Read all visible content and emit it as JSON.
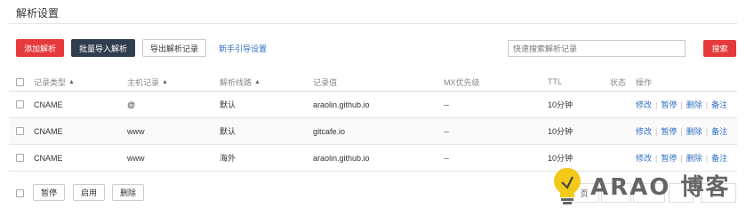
{
  "page": {
    "title": "解析设置"
  },
  "toolbar": {
    "add_label": "添加解析",
    "batch_import_label": "批量导入解析",
    "export_label": "导出解析记录",
    "guide_label": "新手引导设置"
  },
  "search": {
    "placeholder": "快速搜索解析记录",
    "button_label": "搜索"
  },
  "table": {
    "columns": [
      "记录类型",
      "主机记录",
      "解析线路",
      "记录值",
      "MX优先级",
      "TTL",
      "状态",
      "操作"
    ],
    "rows": [
      {
        "type": "CNAME",
        "host": "@",
        "line": "默认",
        "value": "araolin.github.io",
        "mx": "--",
        "ttl": "10分钟",
        "status": ""
      },
      {
        "type": "CNAME",
        "host": "www",
        "line": "默认",
        "value": "gitcafe.io",
        "mx": "--",
        "ttl": "10分钟",
        "status": ""
      },
      {
        "type": "CNAME",
        "host": "www",
        "line": "海外",
        "value": "araolin.github.io",
        "mx": "--",
        "ttl": "10分钟",
        "status": ""
      }
    ],
    "actions": {
      "modify": "修改",
      "pause": "暂停",
      "delete": "删除",
      "remark": "备注"
    }
  },
  "footer": {
    "pause_label": "暂停",
    "enable_label": "启用",
    "delete_label": "删除",
    "pager_partial": "页"
  },
  "watermark": {
    "text": "ARAO 博客"
  },
  "colors": {
    "accent_red": "#e5393b",
    "dark_button": "#2f3d4e",
    "link_blue": "#2f6fc4"
  }
}
